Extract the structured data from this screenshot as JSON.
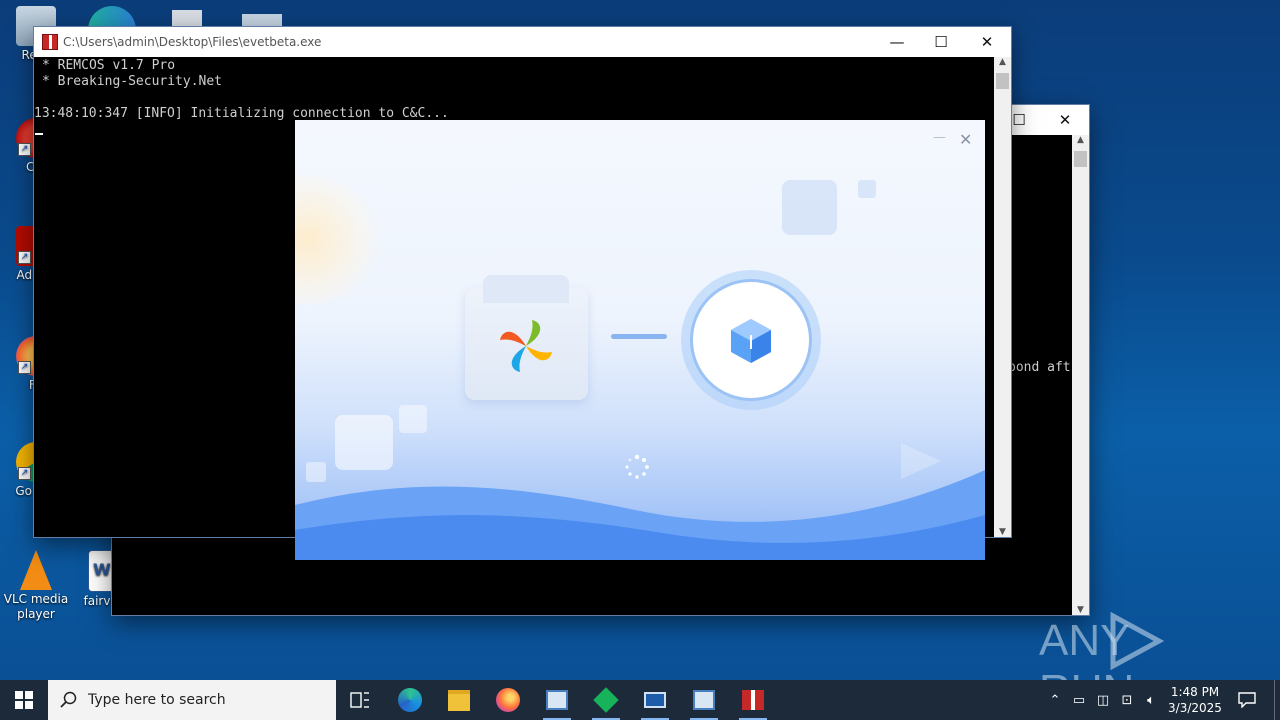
{
  "desktop": {
    "icons": [
      {
        "label": "Recy"
      },
      {
        "label": "CCl"
      },
      {
        "label": "Ad Acr"
      },
      {
        "label": "Fir"
      },
      {
        "label": "Go Chr"
      },
      {
        "label": "VLC media player"
      },
      {
        "label": "fairvill"
      }
    ]
  },
  "console_main": {
    "title": "C:\\Users\\admin\\Desktop\\Files\\evetbeta.exe",
    "lines": [
      "* REMCOS v1.7 Pro",
      "* Breaking-Security.Net",
      "",
      "13:48:10:347 [INFO] Initializing connection to C&C..."
    ],
    "buttons": {
      "minimize": "—",
      "maximize": "☐",
      "close": "✕"
    }
  },
  "console_back": {
    "partial_text": "pond aft",
    "buttons": {
      "maximize": "☐",
      "close": "✕"
    }
  },
  "installer": {
    "buttons": {
      "minimize": "—",
      "close": "✕"
    }
  },
  "watermark": {
    "text": "ANY RUN"
  },
  "taskbar": {
    "search_placeholder": "Type here to search",
    "clock": {
      "time": "1:48 PM",
      "date": "3/3/2025"
    }
  },
  "colors": {
    "accent": "#3d86f4",
    "taskbar": "#1c2a3a",
    "desktop": "#0b5fa8"
  }
}
